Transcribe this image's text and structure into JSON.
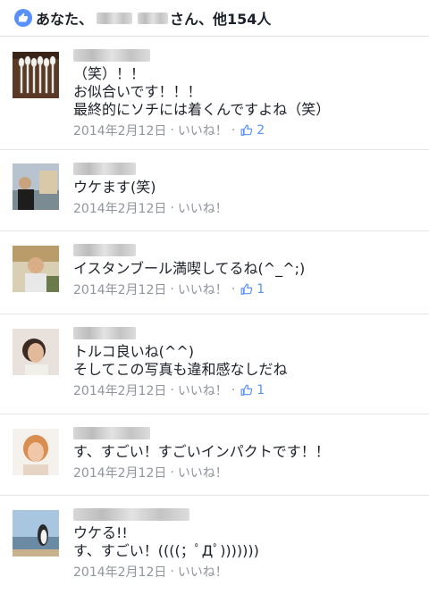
{
  "header": {
    "prefix": "あなた、",
    "suffix": "さん、他154人"
  },
  "comments": [
    {
      "text": "（笑）！！\nお似合いです！！！\n最終的にソチには着くんですよね（笑）",
      "date": "2014年2月12日",
      "like_label": "いいね！",
      "like_count": "2",
      "avatar": "spoons-photo"
    },
    {
      "text": "ウケます(笑)",
      "date": "2014年2月12日",
      "like_label": "いいね！",
      "like_count": "",
      "avatar": "person-city-photo"
    },
    {
      "text": "イスタンブール満喫してるね(^_^;)",
      "date": "2014年2月12日",
      "like_label": "いいね！",
      "like_count": "1",
      "avatar": "person-photo"
    },
    {
      "text": "トルコ良いね(^^)\nそしてこの写真も違和感なしだね",
      "date": "2014年2月12日",
      "like_label": "いいね！",
      "like_count": "1",
      "avatar": "woman-photo"
    },
    {
      "text": "す、すごい！すごいインパクトです！！",
      "date": "2014年2月12日",
      "like_label": "いいね！",
      "like_count": "",
      "avatar": "woman-orange-photo"
    },
    {
      "text": "ウケる!!\nす、すごい！((((；ﾟДﾟ)))))))",
      "date": "2014年2月12日",
      "like_label": "いいね！",
      "like_count": "",
      "avatar": "penguin-photo"
    }
  ],
  "colors": {
    "accent": "#5890ff",
    "meta": "#90949c"
  }
}
